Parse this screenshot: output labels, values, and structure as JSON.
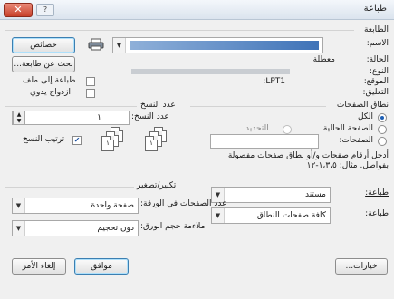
{
  "window": {
    "title": "طباعة",
    "close_glyph": "✕"
  },
  "printer": {
    "section_label": "الطابعة",
    "name_label": "الاسم:",
    "selected": "",
    "properties_button": "خصائص",
    "find_printer_button": "بحث عن طابعة...",
    "status_label": "الحالة:",
    "status_value": "معطلة",
    "type_label": "النوع:",
    "type_value": "",
    "where_label": "الموقع:",
    "where_value": "LPT1:",
    "comment_label": "التعليق:",
    "print_to_file_label": "طباعة إلى ملف",
    "print_to_file_checked": false,
    "manual_duplex_label": "ازدواج يدوي",
    "manual_duplex_checked": false
  },
  "page_range": {
    "title": "نطاق الصفحات",
    "all_label": "الكل",
    "current_page_label": "الصفحة الحالية",
    "selection_label": "التحديد",
    "pages_label": "الصفحات:",
    "selected_option": "all",
    "pages_value": "",
    "hint_line1": "أدخل أرقام صفحات و/أو نطاق صفحات مفصولة",
    "hint_line2": "بفواصل. مثال: ١،٣،٥-١٢"
  },
  "copies": {
    "title": "عدد النسخ",
    "count_label": "عدد النسخ:",
    "count_value": "١",
    "collate_label": "ترتيب النسخ",
    "collate_checked": true,
    "page_glyphs": [
      "١",
      "٢",
      "٣"
    ]
  },
  "print_what": {
    "label": "طباعة:",
    "value": "مستند"
  },
  "print": {
    "label": "طباعة:",
    "value": "كافة صفحات النطاق"
  },
  "zoom": {
    "title": "تكبير/تصغير",
    "pages_per_sheet_label": "عدد الصفحات في الورقة:",
    "pages_per_sheet_value": "صفحة واحدة",
    "scale_label": "ملاءمة حجم الورق:",
    "scale_value": "دون تحجيم"
  },
  "footer": {
    "options_button": "خيارات...",
    "ok_button": "موافق",
    "cancel_button": "إلغاء الأمر"
  }
}
